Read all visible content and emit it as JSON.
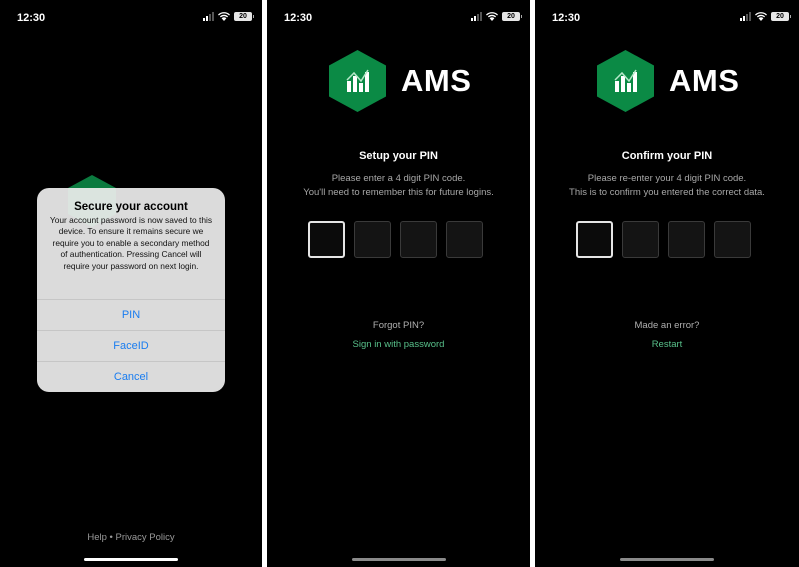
{
  "status_bar": {
    "time": "12:30",
    "battery": "20"
  },
  "screen1": {
    "alert": {
      "title": "Secure your account",
      "message": "Your account password is now saved to this device. To ensure it remains secure we require you to enable a secondary method of authentication. Pressing Cancel will require your password on next login.",
      "buttons": [
        "PIN",
        "FaceID",
        "Cancel"
      ]
    },
    "footer": {
      "help": "Help",
      "separator": "•",
      "privacy": "Privacy Policy"
    }
  },
  "logo": {
    "text": "AMS",
    "icon": "bar-chart-icon"
  },
  "screen2": {
    "heading": "Setup your PIN",
    "line1": "Please enter a 4 digit PIN code.",
    "line2": "You'll need to remember this for future logins.",
    "question": "Forgot PIN?",
    "action": "Sign in with password"
  },
  "screen3": {
    "heading": "Confirm your PIN",
    "line1": "Please re-enter your 4 digit PIN code.",
    "line2": "This is to confirm you entered the correct data.",
    "question": "Made an error?",
    "action": "Restart"
  },
  "colors": {
    "accent_green": "#0b8a45",
    "link_green": "#58c08a",
    "ios_blue": "#1a7df0",
    "background": "#000000"
  }
}
